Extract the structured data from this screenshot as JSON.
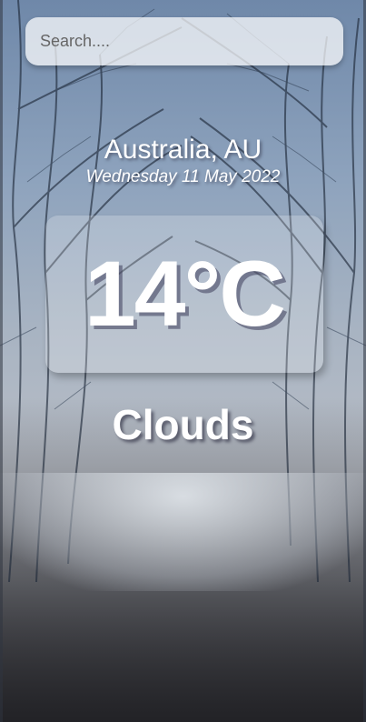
{
  "search": {
    "placeholder": "Search...."
  },
  "location": {
    "name": "Australia, AU",
    "date": "Wednesday 11 May 2022"
  },
  "weather": {
    "temperature": "14°C",
    "condition": "Clouds"
  }
}
